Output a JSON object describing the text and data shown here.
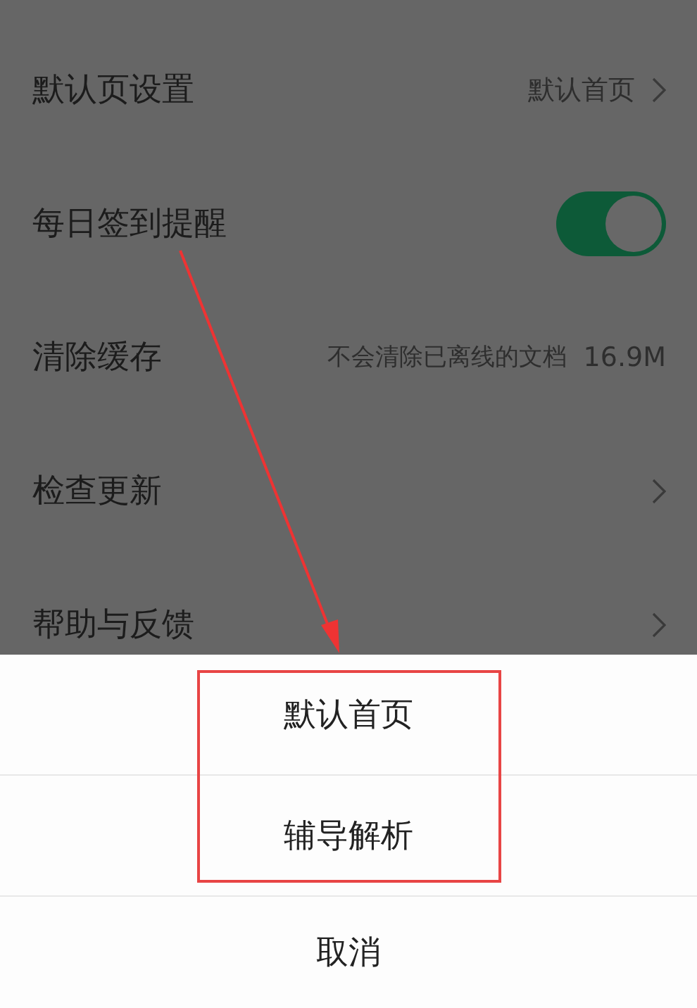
{
  "settings": [
    {
      "kind": "link",
      "label": "默认页设置",
      "value": "默认首页"
    },
    {
      "kind": "toggle",
      "label": "每日签到提醒",
      "on": true
    },
    {
      "kind": "info",
      "label": "清除缓存",
      "note": "不会清除已离线的文档",
      "value": "16.9M"
    },
    {
      "kind": "link",
      "label": "检查更新"
    },
    {
      "kind": "link",
      "label": "帮助与反馈"
    }
  ],
  "action_sheet": {
    "options": [
      "默认首页",
      "辅导解析"
    ],
    "cancel": "取消"
  }
}
